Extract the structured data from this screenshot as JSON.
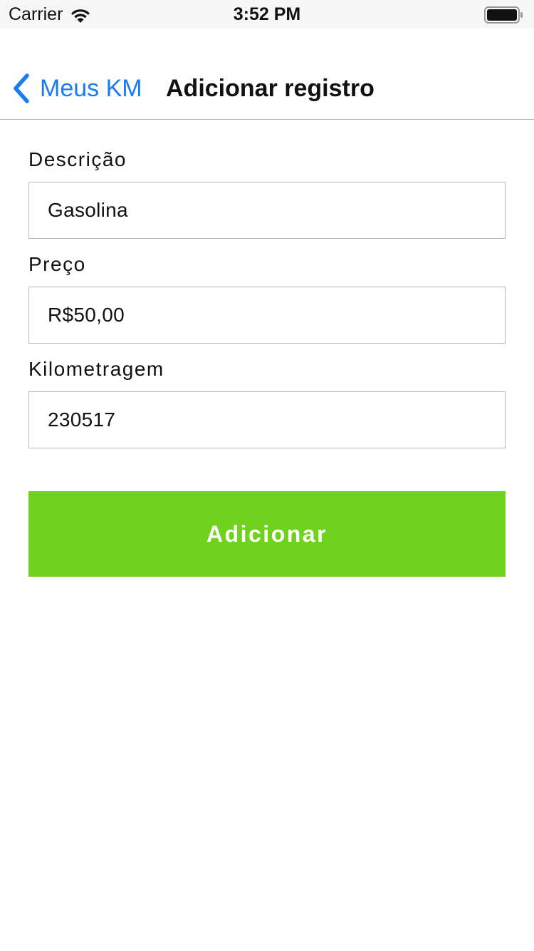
{
  "status_bar": {
    "carrier": "Carrier",
    "time": "3:52 PM",
    "wifi_icon": "wifi-icon",
    "battery_icon": "battery-icon"
  },
  "nav": {
    "back_label": "Meus KM",
    "back_icon": "chevron-left-icon",
    "title": "Adicionar registro",
    "accent_color": "#1a7cf2"
  },
  "form": {
    "description": {
      "label": "Descrição",
      "value": "Gasolina"
    },
    "price": {
      "label": "Preço",
      "value": "R$50,00"
    },
    "mileage": {
      "label": "Kilometragem",
      "value": "230517"
    }
  },
  "actions": {
    "submit_label": "Adicionar",
    "submit_color": "#6fd21c"
  }
}
